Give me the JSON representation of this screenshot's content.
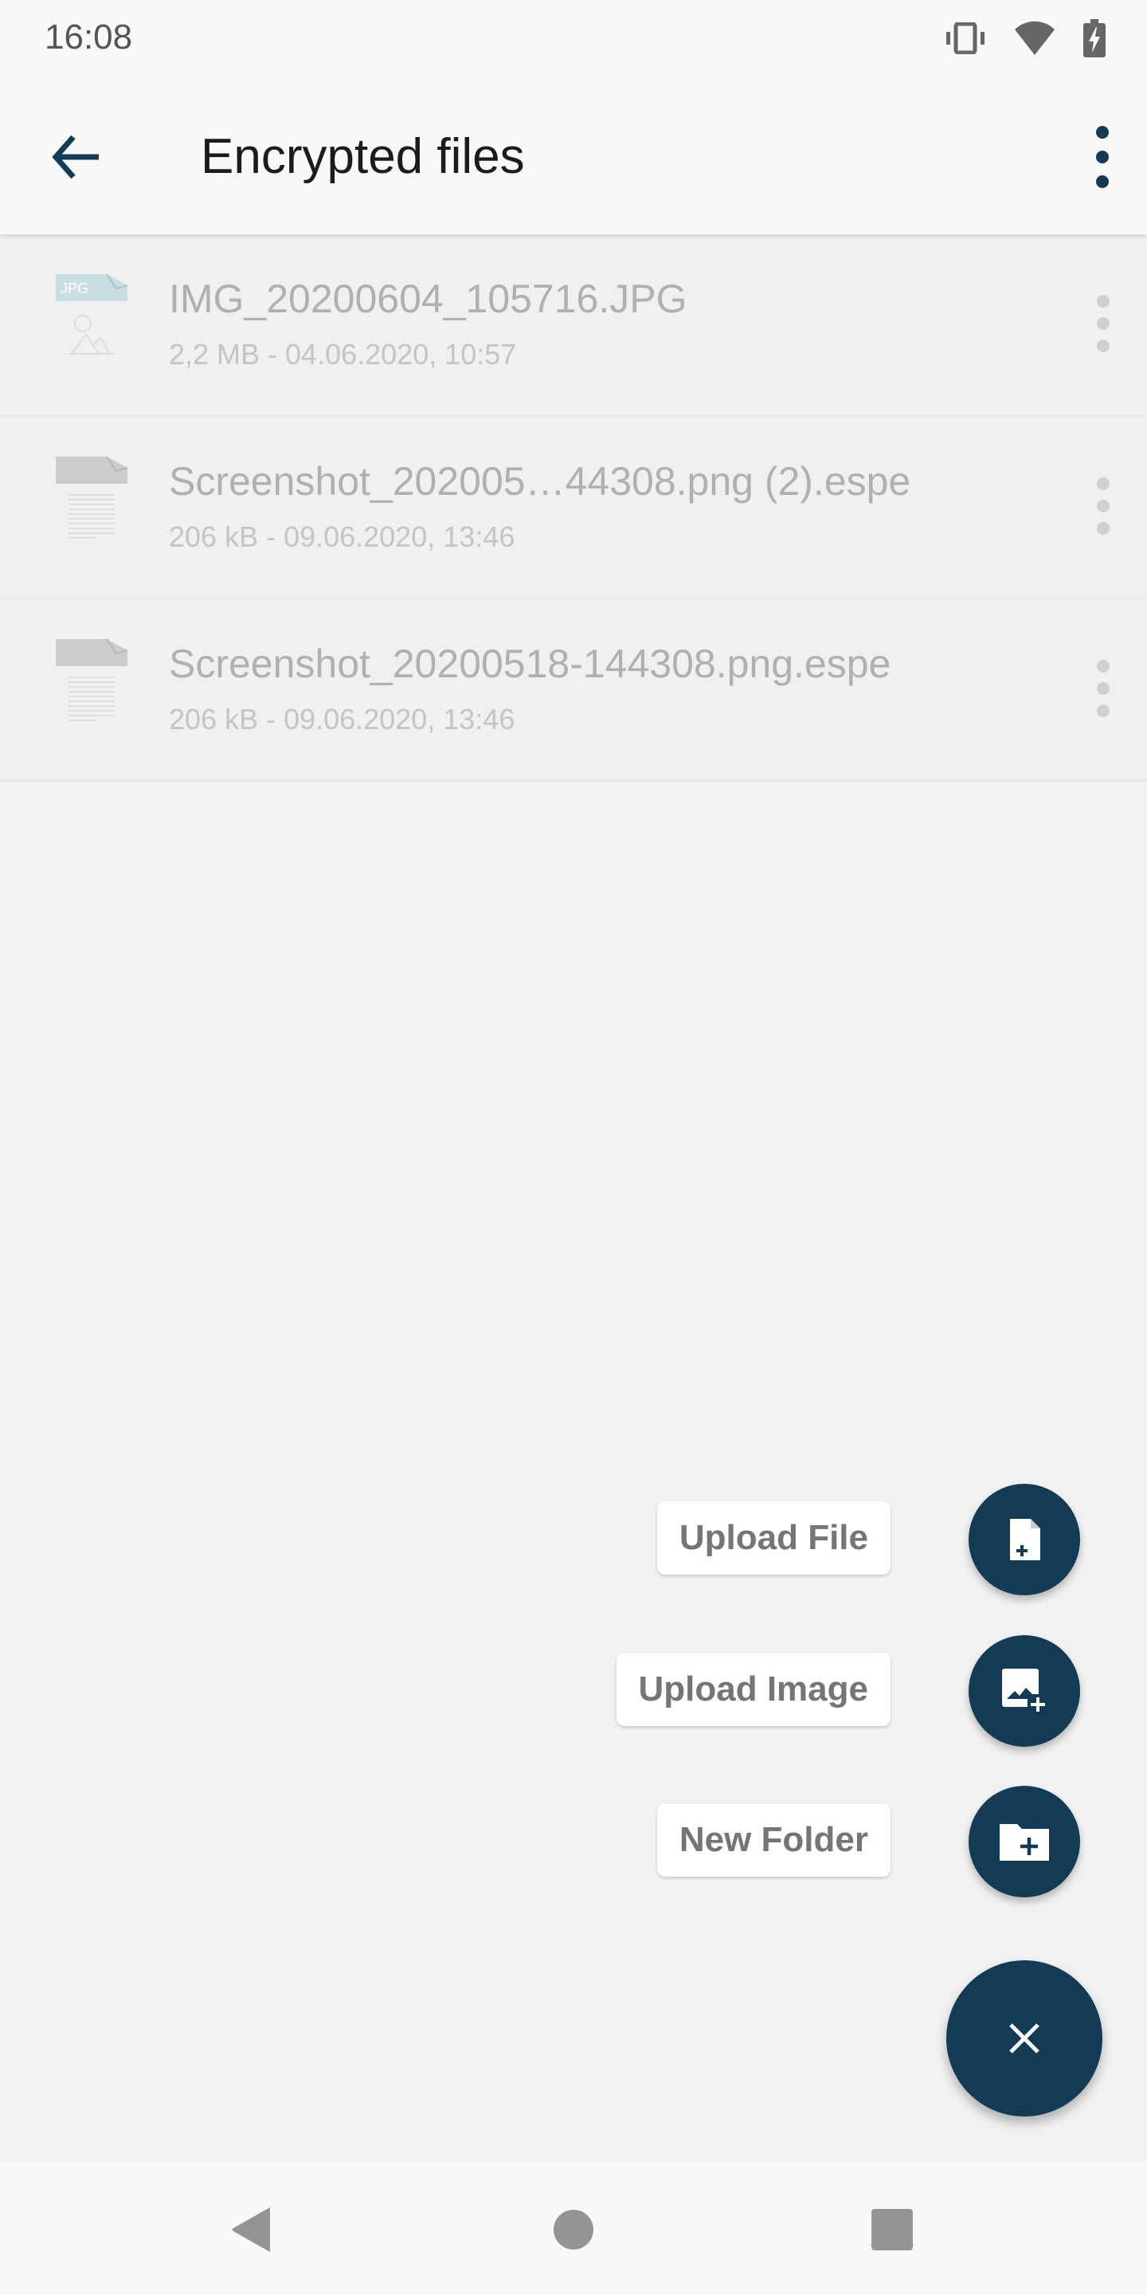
{
  "status_bar": {
    "time": "16:08",
    "icons": [
      "vibrate-icon",
      "wifi-icon",
      "battery-charging-icon"
    ]
  },
  "app_bar": {
    "title": "Encrypted files",
    "back_icon": "arrow-back-icon",
    "menu_icon": "more-vert-icon"
  },
  "files": [
    {
      "name": "IMG_20200604_105716.JPG",
      "meta": "2,2 MB - 04.06.2020, 10:57",
      "type": "JPG",
      "icon": "jpg-file-icon"
    },
    {
      "name": "Screenshot_202005…44308.png (2).espe",
      "meta": "206 kB - 09.06.2020, 13:46",
      "type": "document",
      "icon": "document-file-icon"
    },
    {
      "name": "Screenshot_20200518-144308.png.espe",
      "meta": "206 kB - 09.06.2020, 13:46",
      "type": "document",
      "icon": "document-file-icon"
    }
  ],
  "fab_menu": {
    "items": [
      {
        "label": "Upload File",
        "icon": "file-plus-icon"
      },
      {
        "label": "Upload Image",
        "icon": "image-plus-icon"
      },
      {
        "label": "New Folder",
        "icon": "folder-plus-icon"
      }
    ],
    "close_icon": "close-icon"
  },
  "colors": {
    "accent": "#133b55",
    "background": "#f2f2f2",
    "bar": "#f8f8f8"
  },
  "nav_bar": [
    "back-triangle-icon",
    "home-circle-icon",
    "recents-square-icon"
  ]
}
